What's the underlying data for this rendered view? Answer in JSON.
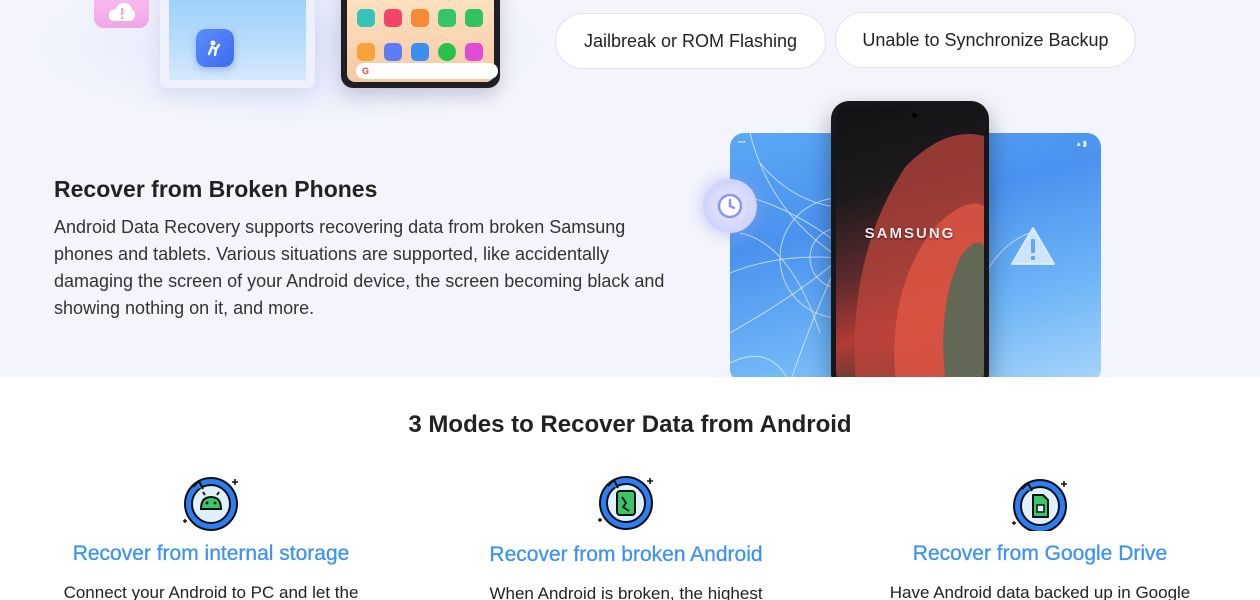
{
  "situations": {
    "pill_1": "Jailbreak or ROM Flashing",
    "pill_2": "Unable to Synchronize Backup"
  },
  "broken_phones": {
    "title": "Recover from Broken Phones",
    "description": "Android Data Recovery supports recovering data from broken Samsung phones and tablets. Various situations are supported, like accidentally damaging the screen of your Android device, the screen becoming black and showing nothing on it, and more.",
    "phone_brand": "SAMSUNG"
  },
  "modes": {
    "title": "3 Modes to Recover Data from Android",
    "items": [
      {
        "title": "Recover from internal storage",
        "text": "Connect your Android to PC and let the",
        "icon": "android-refresh-icon"
      },
      {
        "title": "Recover from broken Android",
        "text": "When Android is broken, the highest",
        "icon": "broken-phone-refresh-icon"
      },
      {
        "title": "Recover from Google Drive",
        "text": "Have Android data backed up in Google",
        "icon": "sd-card-refresh-icon"
      }
    ]
  },
  "colors": {
    "accent_blue": "#3d93f1",
    "section_bg": "#f4f5fc",
    "icon_blue": "#2f7df5"
  }
}
